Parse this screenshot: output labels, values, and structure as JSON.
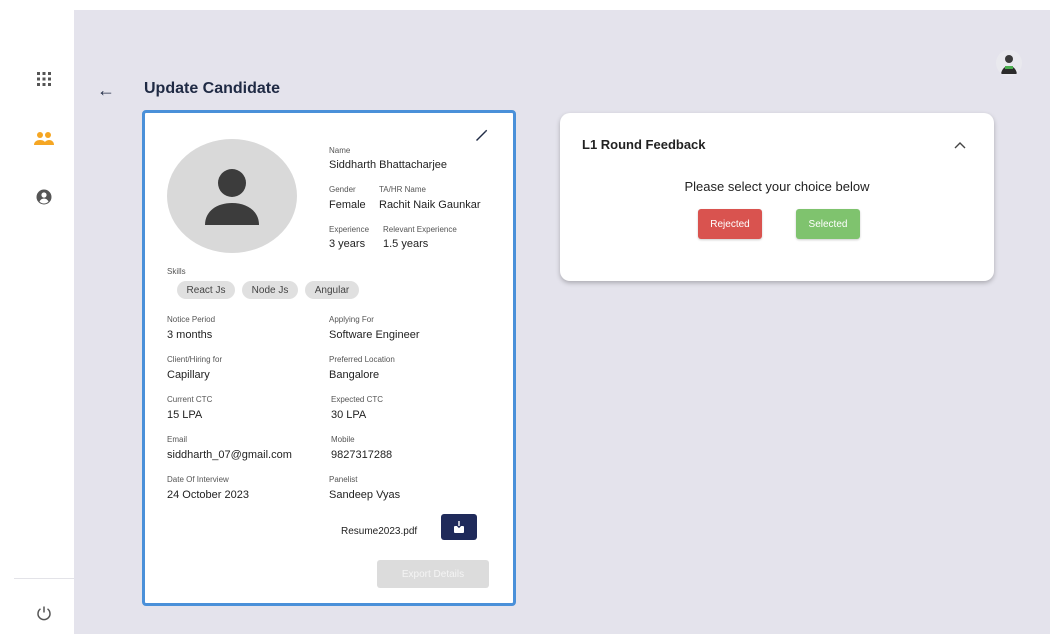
{
  "sidebar": {
    "items": [
      {
        "icon": "apps-grid-icon"
      },
      {
        "icon": "people-icon",
        "active": true
      },
      {
        "icon": "account-circle-icon"
      }
    ],
    "power_icon": "power-icon"
  },
  "header": {
    "back_icon": "←",
    "title": "Update Candidate"
  },
  "colors": {
    "accent": "#f5a623",
    "sidebar_icon": "#555555",
    "title": "#1f2a44",
    "card_border": "#4a90d9",
    "reject": "#d9534f",
    "select": "#7fc36e",
    "download": "#1f2a5a"
  },
  "candidate": {
    "name_label": "Name",
    "name": "Siddharth Bhattacharjee",
    "gender_label": "Gender",
    "gender": "Female",
    "ta_label": "TA/HR Name",
    "ta": "Rachit Naik Gaunkar",
    "experience_label": "Experience",
    "experience": "3 years",
    "relevant_label": "Relevant Experience",
    "relevant": "1.5 years",
    "skills_label": "Skills",
    "skills": [
      "React Js",
      "Node Js",
      "Angular"
    ],
    "notice_label": "Notice Period",
    "notice": "3 months",
    "applying_label": "Applying For",
    "applying": "Software Engineer",
    "client_label": "Client/Hiring for",
    "client": "Capillary",
    "location_label": "Preferred Location",
    "location": "Bangalore",
    "current_ctc_label": "Current CTC",
    "current_ctc": "15 LPA",
    "expected_ctc_label": "Expected CTC",
    "expected_ctc": "30 LPA",
    "email_label": "Email",
    "email": "siddharth_07@gmail.com",
    "mobile_label": "Mobile",
    "mobile": "9827317288",
    "doi_label": "Date Of Interview",
    "doi": "24 October 2023",
    "panelist_label": "Panelist",
    "panelist": "Sandeep Vyas",
    "resume_file": "Resume2023.pdf",
    "export_label": "Export Details"
  },
  "feedback": {
    "title": "L1 Round Feedback",
    "prompt": "Please select your choice below",
    "reject_label": "Rejected",
    "select_label": "Selected"
  }
}
